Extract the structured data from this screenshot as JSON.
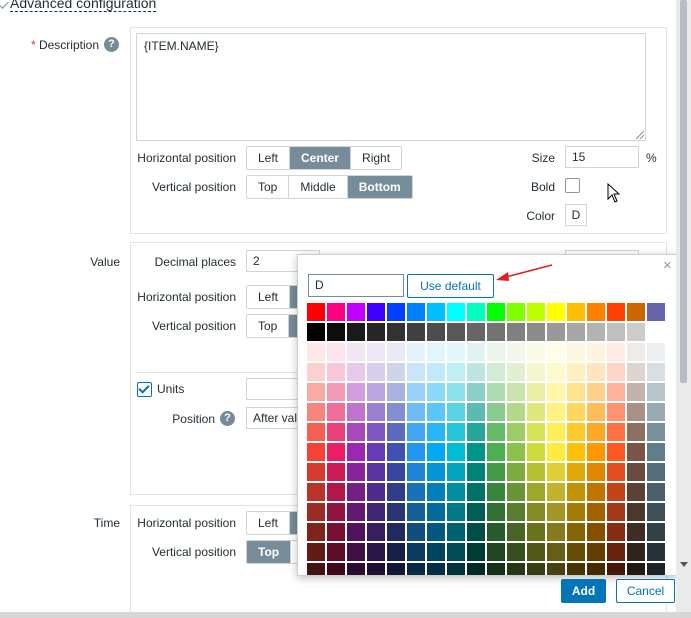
{
  "header": {
    "title": "Advanced configuration"
  },
  "description": {
    "label": "Description",
    "value": "{ITEM.NAME}",
    "horizontal_position_label": "Horizontal position",
    "horizontal_options": [
      "Left",
      "Center",
      "Right"
    ],
    "vertical_position_label": "Vertical position",
    "vertical_options": [
      "Top",
      "Middle",
      "Bottom"
    ],
    "size_label": "Size",
    "size_value": "15",
    "size_unit": "%",
    "bold_label": "Bold",
    "color_label": "Color",
    "color_value": "D"
  },
  "value": {
    "label": "Value",
    "decimal_places_label": "Decimal places",
    "decimal_places_value": "2",
    "horizontal_position_label": "Horizontal position",
    "horizontal_first": "Left",
    "vertical_position_label": "Vertical position",
    "vertical_first": "Top",
    "units_label": "Units",
    "position_label": "Position",
    "position_value": "After valu"
  },
  "time": {
    "label": "Time",
    "horizontal_position_label": "Horizontal position",
    "horizontal_first": "Left",
    "vertical_position_label": "Vertical position",
    "vertical_first": "Top"
  },
  "color_picker": {
    "input_value": "D",
    "use_default_label": "Use default",
    "close_glyph": "×",
    "palette_columns": 18,
    "palette_rows": 14
  },
  "footer": {
    "add_label": "Add",
    "cancel_label": "Cancel"
  },
  "colors": {
    "accent": "#0275b8",
    "segment_selected": "#768d99",
    "required_star": "#e33734",
    "annotation_arrow": "#e02020"
  }
}
